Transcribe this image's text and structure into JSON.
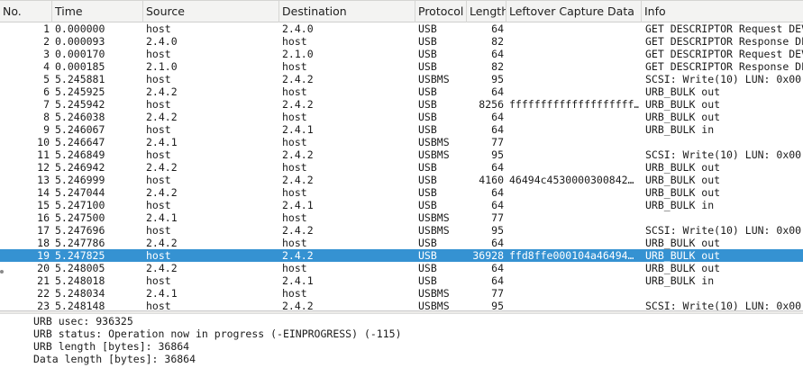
{
  "columns": {
    "no": "No.",
    "time": "Time",
    "source": "Source",
    "destination": "Destination",
    "protocol": "Protocol",
    "length": "Length",
    "leftover": "Leftover Capture Data",
    "info": "Info"
  },
  "packets": [
    {
      "no": "1",
      "time": "0.000000",
      "source": "host",
      "destination": "2.4.0",
      "protocol": "USB",
      "length": "64",
      "leftover": "",
      "info": "GET DESCRIPTOR Request DEVICE"
    },
    {
      "no": "2",
      "time": "0.000093",
      "source": "2.4.0",
      "destination": "host",
      "protocol": "USB",
      "length": "82",
      "leftover": "",
      "info": "GET DESCRIPTOR Response DEVICE"
    },
    {
      "no": "3",
      "time": "0.000170",
      "source": "host",
      "destination": "2.1.0",
      "protocol": "USB",
      "length": "64",
      "leftover": "",
      "info": "GET DESCRIPTOR Request DEVICE"
    },
    {
      "no": "4",
      "time": "0.000185",
      "source": "2.1.0",
      "destination": "host",
      "protocol": "USB",
      "length": "82",
      "leftover": "",
      "info": "GET DESCRIPTOR Response DEVICE"
    },
    {
      "no": "5",
      "time": "5.245881",
      "source": "host",
      "destination": "2.4.2",
      "protocol": "USBMS",
      "length": "95",
      "leftover": "",
      "info": "SCSI: Write(10) LUN: 0x00"
    },
    {
      "no": "6",
      "time": "5.245925",
      "source": "2.4.2",
      "destination": "host",
      "protocol": "USB",
      "length": "64",
      "leftover": "",
      "info": "URB_BULK out"
    },
    {
      "no": "7",
      "time": "5.245942",
      "source": "host",
      "destination": "2.4.2",
      "protocol": "USB",
      "length": "8256",
      "leftover": "ffffffffffffffffffff…",
      "info": "URB_BULK out"
    },
    {
      "no": "8",
      "time": "5.246038",
      "source": "2.4.2",
      "destination": "host",
      "protocol": "USB",
      "length": "64",
      "leftover": "",
      "info": "URB_BULK out"
    },
    {
      "no": "9",
      "time": "5.246067",
      "source": "host",
      "destination": "2.4.1",
      "protocol": "USB",
      "length": "64",
      "leftover": "",
      "info": "URB_BULK in"
    },
    {
      "no": "10",
      "time": "5.246647",
      "source": "2.4.1",
      "destination": "host",
      "protocol": "USBMS",
      "length": "77",
      "leftover": "",
      "info": ""
    },
    {
      "no": "11",
      "time": "5.246849",
      "source": "host",
      "destination": "2.4.2",
      "protocol": "USBMS",
      "length": "95",
      "leftover": "",
      "info": "SCSI: Write(10) LUN: 0x00"
    },
    {
      "no": "12",
      "time": "5.246942",
      "source": "2.4.2",
      "destination": "host",
      "protocol": "USB",
      "length": "64",
      "leftover": "",
      "info": "URB_BULK out"
    },
    {
      "no": "13",
      "time": "5.246999",
      "source": "host",
      "destination": "2.4.2",
      "protocol": "USB",
      "length": "4160",
      "leftover": "46494c4530000300842…",
      "info": "URB_BULK out"
    },
    {
      "no": "14",
      "time": "5.247044",
      "source": "2.4.2",
      "destination": "host",
      "protocol": "USB",
      "length": "64",
      "leftover": "",
      "info": "URB_BULK out"
    },
    {
      "no": "15",
      "time": "5.247100",
      "source": "host",
      "destination": "2.4.1",
      "protocol": "USB",
      "length": "64",
      "leftover": "",
      "info": "URB_BULK in"
    },
    {
      "no": "16",
      "time": "5.247500",
      "source": "2.4.1",
      "destination": "host",
      "protocol": "USBMS",
      "length": "77",
      "leftover": "",
      "info": ""
    },
    {
      "no": "17",
      "time": "5.247696",
      "source": "host",
      "destination": "2.4.2",
      "protocol": "USBMS",
      "length": "95",
      "leftover": "",
      "info": "SCSI: Write(10) LUN: 0x00"
    },
    {
      "no": "18",
      "time": "5.247786",
      "source": "2.4.2",
      "destination": "host",
      "protocol": "USB",
      "length": "64",
      "leftover": "",
      "info": "URB_BULK out"
    },
    {
      "no": "19",
      "time": "5.247825",
      "source": "host",
      "destination": "2.4.2",
      "protocol": "USB",
      "length": "36928",
      "leftover": "ffd8ffe000104a46494…",
      "info": "URB_BULK out",
      "selected": true
    },
    {
      "no": "20",
      "time": "5.248005",
      "source": "2.4.2",
      "destination": "host",
      "protocol": "USB",
      "length": "64",
      "leftover": "",
      "info": "URB_BULK out",
      "marker": true
    },
    {
      "no": "21",
      "time": "5.248018",
      "source": "host",
      "destination": "2.4.1",
      "protocol": "USB",
      "length": "64",
      "leftover": "",
      "info": "URB_BULK in"
    },
    {
      "no": "22",
      "time": "5.248034",
      "source": "2.4.1",
      "destination": "host",
      "protocol": "USBMS",
      "length": "77",
      "leftover": "",
      "info": ""
    },
    {
      "no": "23",
      "time": "5.248148",
      "source": "host",
      "destination": "2.4.2",
      "protocol": "USBMS",
      "length": "95",
      "leftover": "",
      "info": "SCSI: Write(10) LUN: 0x00"
    }
  ],
  "details": [
    "URB usec: 936325",
    "URB status: Operation now in progress (-EINPROGRESS) (-115)",
    "URB length [bytes]: 36864",
    "Data length [bytes]: 36864"
  ],
  "colors": {
    "selected_row": "#3592d2",
    "header_bg": "#f3f3f2"
  }
}
